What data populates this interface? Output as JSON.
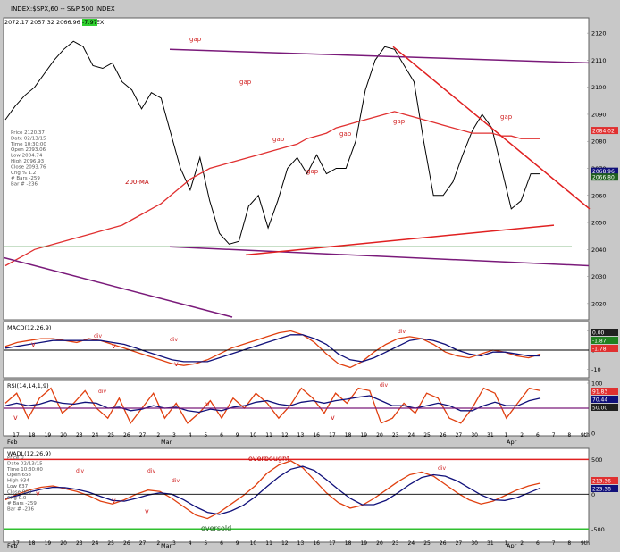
{
  "window": {
    "title": "INDEX:$SPX,60 -- S&P 500 INDEX",
    "quote": {
      "open": "2072.17",
      "low": "2057.32",
      "close": "2066.96",
      "change": "-7.97"
    }
  },
  "chart_data": [
    {
      "type": "line",
      "panel": "price",
      "title": "INDEX:$SPX,60 -- S&P 500 INDEX",
      "ylim": [
        2015,
        2125
      ],
      "yticks": [
        2020,
        2030,
        2040,
        2050,
        2060,
        2070,
        2080,
        2090,
        2100,
        2110,
        2120
      ],
      "series": [
        {
          "name": "",
          "values": [
            2088,
            2093,
            2097,
            2100,
            2105,
            2110,
            2114,
            2117,
            2115,
            2108,
            2107,
            2109,
            2102,
            2099,
            2092,
            2098,
            2096,
            2083,
            2070,
            2062,
            2074,
            2058,
            2046,
            2042,
            2043,
            2056,
            2060,
            2048,
            2058,
            2070,
            2074,
            2068,
            2075,
            2068,
            2070,
            2070,
            2080,
            2099,
            2110,
            2115,
            2114,
            2108,
            2102,
            2080,
            2060,
            2060,
            2065,
            2075,
            2084,
            2090,
            2085,
            2070,
            2055,
            2058,
            2068,
            2068
          ]
        },
        {
          "name": "200-MA",
          "values": [
            2034,
            2036,
            2038,
            2040,
            2041,
            2042,
            2043,
            2044,
            2045,
            2046,
            2047,
            2048,
            2049,
            2051,
            2053,
            2055,
            2057,
            2060,
            2063,
            2066,
            2068,
            2070,
            2071,
            2072,
            2073,
            2074,
            2075,
            2076,
            2077,
            2078,
            2079,
            2081,
            2082,
            2083,
            2085,
            2086,
            2087,
            2088,
            2089,
            2090,
            2091,
            2090,
            2089,
            2088,
            2087,
            2086,
            2085,
            2084,
            2083,
            2083,
            2083,
            2082,
            2082,
            2081,
            2081,
            2081
          ]
        }
      ],
      "price_panel": {
        "price_box": {
          "Price": "2120.37",
          "Date": "02/13/15",
          "Time": "10:30:00",
          "Open": "2093.06",
          "Low": "2084.74",
          "High": "2096.93",
          "Close": "2093.76",
          "Chg %": "1.2",
          "# Bars": "-259",
          "Bar #": "-236"
        },
        "labels": {
          "ma": "200-MA",
          "gap": "gap"
        },
        "value_tags": [
          {
            "value": "2084.02",
            "color": "#e03030"
          },
          {
            "value": "2068.96",
            "color": "#10107a"
          },
          {
            "value": "2066.80",
            "color": "#206020"
          }
        ]
      }
    },
    {
      "type": "line",
      "panel": "macd",
      "title": "MACD(12,26,9)",
      "ylim": [
        -13,
        13
      ],
      "yticks": [
        10,
        0,
        -10
      ],
      "series": [
        {
          "name": "MACD",
          "values": [
            2,
            4,
            5,
            6,
            6,
            5,
            4,
            6,
            5,
            3,
            1,
            -1,
            -3,
            -5,
            -7,
            -8,
            -7,
            -5,
            -2,
            1,
            3,
            5,
            7,
            9,
            10,
            8,
            4,
            -2,
            -7,
            -9,
            -6,
            -1,
            3,
            6,
            7,
            6,
            3,
            -1,
            -3,
            -4,
            -2,
            0,
            -1,
            -3,
            -4,
            -2
          ]
        },
        {
          "name": "Signal",
          "values": [
            1,
            2,
            3,
            4,
            5,
            5,
            5,
            5,
            5,
            4,
            3,
            1,
            -1,
            -3,
            -5,
            -6,
            -6,
            -6,
            -4,
            -2,
            0,
            2,
            4,
            6,
            8,
            8,
            6,
            3,
            -2,
            -5,
            -6,
            -4,
            -1,
            2,
            5,
            6,
            5,
            3,
            0,
            -2,
            -3,
            -1,
            -1,
            -2,
            -3,
            -3
          ]
        }
      ],
      "macd_panel": {
        "div_label": "div",
        "v_label": "v",
        "value_tags": [
          {
            "value": "0.00",
            "color": "#202020"
          },
          {
            "value": "-1.87",
            "color": "#208020"
          },
          {
            "value": "-1.78",
            "color": "#e03030"
          }
        ]
      }
    },
    {
      "type": "line",
      "panel": "rsi",
      "title": "RSI(14,14,1,9)",
      "ylim": [
        0,
        100
      ],
      "yticks": [
        100,
        50,
        0
      ],
      "series": [
        {
          "name": "RSI",
          "values": [
            60,
            80,
            30,
            70,
            90,
            40,
            60,
            85,
            50,
            30,
            70,
            20,
            50,
            80,
            30,
            60,
            20,
            40,
            65,
            30,
            70,
            50,
            80,
            60,
            30,
            55,
            90,
            70,
            40,
            80,
            60,
            90,
            85,
            20,
            30,
            60,
            40,
            80,
            70,
            30,
            20,
            50,
            90,
            80,
            30,
            60,
            90,
            85
          ]
        },
        {
          "name": "Signal",
          "values": [
            55,
            60,
            55,
            58,
            65,
            60,
            58,
            62,
            60,
            50,
            52,
            45,
            48,
            55,
            50,
            52,
            45,
            42,
            48,
            45,
            52,
            55,
            62,
            65,
            58,
            55,
            62,
            65,
            60,
            65,
            68,
            72,
            75,
            65,
            55,
            55,
            50,
            55,
            60,
            55,
            45,
            45,
            55,
            62,
            55,
            55,
            65,
            70
          ]
        }
      ],
      "rsi_panel": {
        "div_label": "div",
        "v_label": "v",
        "value_tags": [
          {
            "value": "91.83",
            "color": "#e03030"
          },
          {
            "value": "70.44",
            "color": "#10107a"
          },
          {
            "value": "50.00",
            "color": "#202020"
          }
        ]
      }
    },
    {
      "type": "line",
      "panel": "wadl",
      "title": "WADL(12,26,9)",
      "ylim": [
        -650,
        620
      ],
      "yticks": [
        500,
        0,
        -500
      ],
      "series": [
        {
          "name": "MACD",
          "values": [
            -80,
            0,
            60,
            100,
            120,
            80,
            40,
            -20,
            -100,
            -140,
            -80,
            0,
            60,
            40,
            -60,
            -180,
            -300,
            -350,
            -260,
            -140,
            -20,
            120,
            300,
            420,
            480,
            380,
            200,
            20,
            -120,
            -200,
            -160,
            -60,
            60,
            180,
            280,
            320,
            260,
            140,
            20,
            -80,
            -140,
            -100,
            -20,
            60,
            120,
            160
          ]
        },
        {
          "name": "Signal",
          "values": [
            -60,
            -20,
            30,
            70,
            100,
            95,
            70,
            30,
            -30,
            -90,
            -100,
            -60,
            -10,
            20,
            0,
            -80,
            -180,
            -260,
            -290,
            -240,
            -160,
            -40,
            110,
            250,
            360,
            400,
            340,
            210,
            70,
            -60,
            -150,
            -150,
            -90,
            20,
            140,
            240,
            280,
            260,
            190,
            90,
            -10,
            -80,
            -90,
            -50,
            20,
            90
          ]
        }
      ],
      "wadl_panel": {
        "price_box": {
          "Price": "0",
          "Date": "02/13/15",
          "Time": "10:30:00",
          "Open": "658",
          "High": "934",
          "Low": "637",
          "Close": "900",
          "Chg": "0.0",
          "# Bars": "-259",
          "Bar #": "-236"
        },
        "labels": {
          "overbought": "overbought",
          "oversold": "oversold",
          "div": "div",
          "v": "v"
        },
        "value_tags": [
          {
            "value": "213.36",
            "color": "#e03030"
          },
          {
            "value": "223.38",
            "color": "#10107a"
          }
        ]
      }
    }
  ],
  "x_axis": {
    "ticks": [
      "17",
      "18",
      "19",
      "20",
      "23",
      "24",
      "25",
      "26",
      "27",
      "2",
      "3",
      "4",
      "5",
      "6",
      "9",
      "10",
      "11",
      "12",
      "13",
      "16",
      "17",
      "18",
      "19",
      "20",
      "23",
      "24",
      "25",
      "26",
      "27",
      "30",
      "31",
      "1",
      "2",
      "6",
      "7",
      "8",
      "9th"
    ],
    "months": [
      "Feb",
      "Mar",
      "Apr"
    ]
  }
}
